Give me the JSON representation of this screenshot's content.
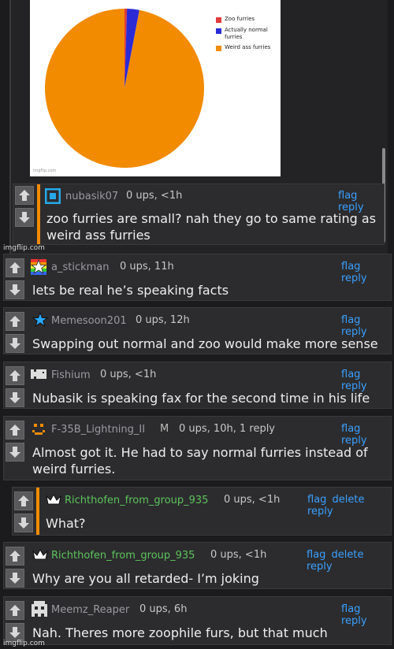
{
  "chart_data": {
    "type": "pie",
    "title": "",
    "legend_position": "top-right",
    "slices": [
      {
        "label": "Zoo furries",
        "value": 0.5,
        "color": "#e03a3a"
      },
      {
        "label": "Actually normal furries",
        "value": 2.5,
        "color": "#2b2bd6"
      },
      {
        "label": "Weird ass furries",
        "value": 97,
        "color": "#f28b00"
      }
    ]
  },
  "chart_legend": [
    "Zoo furries",
    "Actually normal furries",
    "Weird ass furries"
  ],
  "watermark": "imgflip.com",
  "reply_comment": {
    "username": "nubasik07",
    "meta": "0 ups, <1h",
    "actions": "flag reply",
    "text_line1": "zoo furries are small? nah they go to same rating as",
    "text_line2": "weird ass furries"
  },
  "comments": [
    {
      "username": "a_stickman",
      "meta": "0 ups, 11h",
      "actions": "flag reply",
      "text": "lets be real he’s speaking facts"
    },
    {
      "username": "Memesoon201",
      "meta": "0 ups, 12h",
      "actions": "flag reply",
      "text": "Swapping out normal and zoo would make more sense"
    },
    {
      "username": "Fishium",
      "meta": "0 ups, <1h",
      "actions": "flag reply",
      "text": "Nubasik is speaking fax for the second time in his life"
    },
    {
      "username": "F-35B_Lightning_II",
      "badge": "M",
      "meta": "0 ups, 10h, 1 reply",
      "actions": "flag reply",
      "text_line1": "Almost got it. He had to say normal furries instead of",
      "text_line2": "weird furries."
    },
    {
      "username": "Richthofen_from_group_935",
      "meta": "0 ups, <1h",
      "actions": "flag delete reply",
      "text": "What?"
    },
    {
      "username": "Richthofen_from_group_935",
      "meta": "0 ups, <1h",
      "actions": "flag delete reply",
      "text": "Why are you all retarded- I’m joking"
    },
    {
      "username": "Meemz_Reaper",
      "meta": "0 ups, 6h",
      "actions": "flag reply",
      "text": "Nah. Theres more zoophile furs, but that much"
    }
  ],
  "colors": {
    "accent_orange": "#f28b00",
    "link_blue": "#3aa0ff",
    "mod_green": "#5cc45c"
  }
}
